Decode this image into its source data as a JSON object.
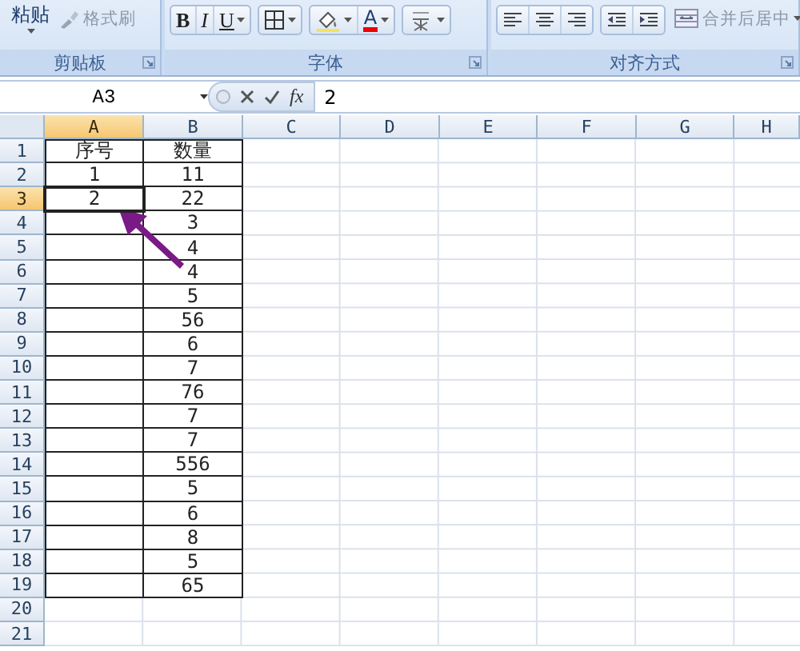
{
  "ribbon": {
    "groups": [
      {
        "label": "剪贴板",
        "segments": [
          [
            {
              "kind": "big",
              "label": "粘贴",
              "dropdown": true
            },
            {
              "kind": "brush",
              "label": "格式刷",
              "disabled": true
            }
          ]
        ]
      },
      {
        "label": "字体",
        "segments": [
          [
            {
              "kind": "bold",
              "label": "B"
            },
            {
              "kind": "italic",
              "label": "I"
            },
            {
              "kind": "underline",
              "label": "U",
              "dropdown": true
            }
          ],
          [
            {
              "kind": "borders",
              "dropdown": true
            }
          ],
          [
            {
              "kind": "fill",
              "dropdown": true
            },
            {
              "kind": "fontcolor",
              "label": "A",
              "dropdown": true
            }
          ],
          [
            {
              "kind": "phonetic",
              "dropdown": true
            }
          ]
        ]
      },
      {
        "label": "对齐方式",
        "segments": [
          [
            {
              "kind": "alignleft"
            },
            {
              "kind": "aligncenter"
            },
            {
              "kind": "alignright"
            }
          ],
          [
            {
              "kind": "outdent"
            },
            {
              "kind": "indent"
            }
          ],
          [
            {
              "kind": "merge",
              "label": "合并后居中",
              "dropdown": true,
              "disabled": true
            }
          ]
        ]
      }
    ]
  },
  "formula_bar": {
    "name_box": "A3",
    "function_label": "fx",
    "formula": "2"
  },
  "sheet": {
    "columns": [
      {
        "label": "A",
        "selected": true
      },
      {
        "label": "B",
        "selected": false
      },
      {
        "label": "C",
        "selected": false
      },
      {
        "label": "D",
        "selected": false
      },
      {
        "label": "E",
        "selected": false
      },
      {
        "label": "F",
        "selected": false
      },
      {
        "label": "G",
        "selected": false
      },
      {
        "label": "H",
        "selected": false
      }
    ],
    "rows": [
      {
        "number": "1",
        "selected": false,
        "bordered": true,
        "cells": [
          "序号",
          "数量"
        ]
      },
      {
        "number": "2",
        "selected": false,
        "bordered": true,
        "cells": [
          "1",
          "11"
        ]
      },
      {
        "number": "3",
        "selected": true,
        "bordered": true,
        "cells": [
          "2",
          "22"
        ]
      },
      {
        "number": "4",
        "selected": false,
        "bordered": true,
        "cells": [
          null,
          "3"
        ]
      },
      {
        "number": "5",
        "selected": false,
        "bordered": true,
        "cells": [
          null,
          "4"
        ]
      },
      {
        "number": "6",
        "selected": false,
        "bordered": true,
        "cells": [
          null,
          "4"
        ]
      },
      {
        "number": "7",
        "selected": false,
        "bordered": true,
        "cells": [
          null,
          "5"
        ]
      },
      {
        "number": "8",
        "selected": false,
        "bordered": true,
        "cells": [
          null,
          "56"
        ]
      },
      {
        "number": "9",
        "selected": false,
        "bordered": true,
        "cells": [
          null,
          "6"
        ]
      },
      {
        "number": "10",
        "selected": false,
        "bordered": true,
        "cells": [
          null,
          "7"
        ]
      },
      {
        "number": "11",
        "selected": false,
        "bordered": true,
        "cells": [
          null,
          "76"
        ]
      },
      {
        "number": "12",
        "selected": false,
        "bordered": true,
        "cells": [
          null,
          "7"
        ]
      },
      {
        "number": "13",
        "selected": false,
        "bordered": true,
        "cells": [
          null,
          "7"
        ]
      },
      {
        "number": "14",
        "selected": false,
        "bordered": true,
        "cells": [
          null,
          "556"
        ]
      },
      {
        "number": "15",
        "selected": false,
        "bordered": true,
        "cells": [
          null,
          "5"
        ]
      },
      {
        "number": "16",
        "selected": false,
        "bordered": true,
        "cells": [
          null,
          "6"
        ]
      },
      {
        "number": "17",
        "selected": false,
        "bordered": true,
        "cells": [
          null,
          "8"
        ]
      },
      {
        "number": "18",
        "selected": false,
        "bordered": true,
        "cells": [
          null,
          "5"
        ]
      },
      {
        "number": "19",
        "selected": false,
        "bordered": true,
        "cells": [
          null,
          "65"
        ]
      },
      {
        "number": "20",
        "selected": false,
        "bordered": false,
        "cells": []
      },
      {
        "number": "21",
        "selected": false,
        "bordered": false,
        "cells": []
      }
    ]
  },
  "annotations": [
    {
      "kind": "arrow",
      "color": "#7a1a86"
    }
  ]
}
